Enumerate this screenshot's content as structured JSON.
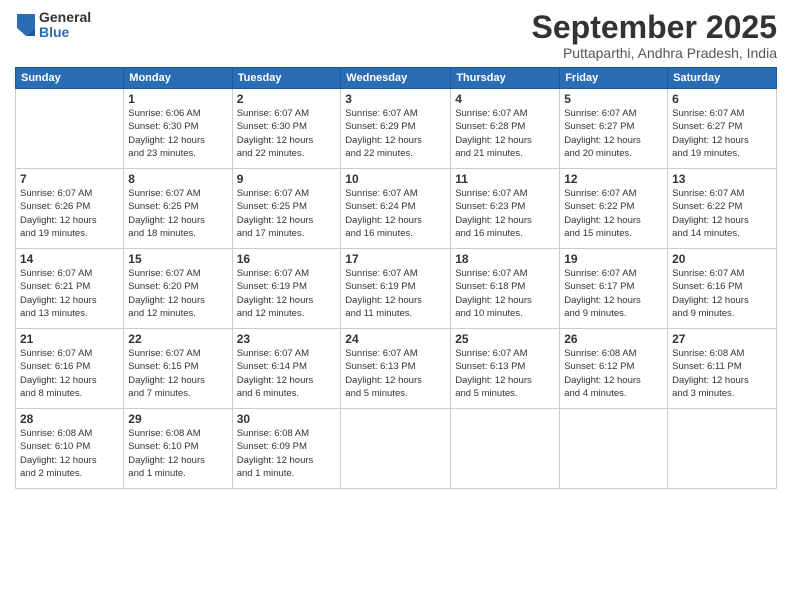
{
  "logo": {
    "general": "General",
    "blue": "Blue"
  },
  "header": {
    "title": "September 2025",
    "location": "Puttaparthi, Andhra Pradesh, India"
  },
  "weekdays": [
    "Sunday",
    "Monday",
    "Tuesday",
    "Wednesday",
    "Thursday",
    "Friday",
    "Saturday"
  ],
  "weeks": [
    [
      {
        "day": "",
        "info": ""
      },
      {
        "day": "1",
        "info": "Sunrise: 6:06 AM\nSunset: 6:30 PM\nDaylight: 12 hours\nand 23 minutes."
      },
      {
        "day": "2",
        "info": "Sunrise: 6:07 AM\nSunset: 6:30 PM\nDaylight: 12 hours\nand 22 minutes."
      },
      {
        "day": "3",
        "info": "Sunrise: 6:07 AM\nSunset: 6:29 PM\nDaylight: 12 hours\nand 22 minutes."
      },
      {
        "day": "4",
        "info": "Sunrise: 6:07 AM\nSunset: 6:28 PM\nDaylight: 12 hours\nand 21 minutes."
      },
      {
        "day": "5",
        "info": "Sunrise: 6:07 AM\nSunset: 6:27 PM\nDaylight: 12 hours\nand 20 minutes."
      },
      {
        "day": "6",
        "info": "Sunrise: 6:07 AM\nSunset: 6:27 PM\nDaylight: 12 hours\nand 19 minutes."
      }
    ],
    [
      {
        "day": "7",
        "info": "Sunrise: 6:07 AM\nSunset: 6:26 PM\nDaylight: 12 hours\nand 19 minutes."
      },
      {
        "day": "8",
        "info": "Sunrise: 6:07 AM\nSunset: 6:25 PM\nDaylight: 12 hours\nand 18 minutes."
      },
      {
        "day": "9",
        "info": "Sunrise: 6:07 AM\nSunset: 6:25 PM\nDaylight: 12 hours\nand 17 minutes."
      },
      {
        "day": "10",
        "info": "Sunrise: 6:07 AM\nSunset: 6:24 PM\nDaylight: 12 hours\nand 16 minutes."
      },
      {
        "day": "11",
        "info": "Sunrise: 6:07 AM\nSunset: 6:23 PM\nDaylight: 12 hours\nand 16 minutes."
      },
      {
        "day": "12",
        "info": "Sunrise: 6:07 AM\nSunset: 6:22 PM\nDaylight: 12 hours\nand 15 minutes."
      },
      {
        "day": "13",
        "info": "Sunrise: 6:07 AM\nSunset: 6:22 PM\nDaylight: 12 hours\nand 14 minutes."
      }
    ],
    [
      {
        "day": "14",
        "info": "Sunrise: 6:07 AM\nSunset: 6:21 PM\nDaylight: 12 hours\nand 13 minutes."
      },
      {
        "day": "15",
        "info": "Sunrise: 6:07 AM\nSunset: 6:20 PM\nDaylight: 12 hours\nand 12 minutes."
      },
      {
        "day": "16",
        "info": "Sunrise: 6:07 AM\nSunset: 6:19 PM\nDaylight: 12 hours\nand 12 minutes."
      },
      {
        "day": "17",
        "info": "Sunrise: 6:07 AM\nSunset: 6:19 PM\nDaylight: 12 hours\nand 11 minutes."
      },
      {
        "day": "18",
        "info": "Sunrise: 6:07 AM\nSunset: 6:18 PM\nDaylight: 12 hours\nand 10 minutes."
      },
      {
        "day": "19",
        "info": "Sunrise: 6:07 AM\nSunset: 6:17 PM\nDaylight: 12 hours\nand 9 minutes."
      },
      {
        "day": "20",
        "info": "Sunrise: 6:07 AM\nSunset: 6:16 PM\nDaylight: 12 hours\nand 9 minutes."
      }
    ],
    [
      {
        "day": "21",
        "info": "Sunrise: 6:07 AM\nSunset: 6:16 PM\nDaylight: 12 hours\nand 8 minutes."
      },
      {
        "day": "22",
        "info": "Sunrise: 6:07 AM\nSunset: 6:15 PM\nDaylight: 12 hours\nand 7 minutes."
      },
      {
        "day": "23",
        "info": "Sunrise: 6:07 AM\nSunset: 6:14 PM\nDaylight: 12 hours\nand 6 minutes."
      },
      {
        "day": "24",
        "info": "Sunrise: 6:07 AM\nSunset: 6:13 PM\nDaylight: 12 hours\nand 5 minutes."
      },
      {
        "day": "25",
        "info": "Sunrise: 6:07 AM\nSunset: 6:13 PM\nDaylight: 12 hours\nand 5 minutes."
      },
      {
        "day": "26",
        "info": "Sunrise: 6:08 AM\nSunset: 6:12 PM\nDaylight: 12 hours\nand 4 minutes."
      },
      {
        "day": "27",
        "info": "Sunrise: 6:08 AM\nSunset: 6:11 PM\nDaylight: 12 hours\nand 3 minutes."
      }
    ],
    [
      {
        "day": "28",
        "info": "Sunrise: 6:08 AM\nSunset: 6:10 PM\nDaylight: 12 hours\nand 2 minutes."
      },
      {
        "day": "29",
        "info": "Sunrise: 6:08 AM\nSunset: 6:10 PM\nDaylight: 12 hours\nand 1 minute."
      },
      {
        "day": "30",
        "info": "Sunrise: 6:08 AM\nSunset: 6:09 PM\nDaylight: 12 hours\nand 1 minute."
      },
      {
        "day": "",
        "info": ""
      },
      {
        "day": "",
        "info": ""
      },
      {
        "day": "",
        "info": ""
      },
      {
        "day": "",
        "info": ""
      }
    ]
  ]
}
